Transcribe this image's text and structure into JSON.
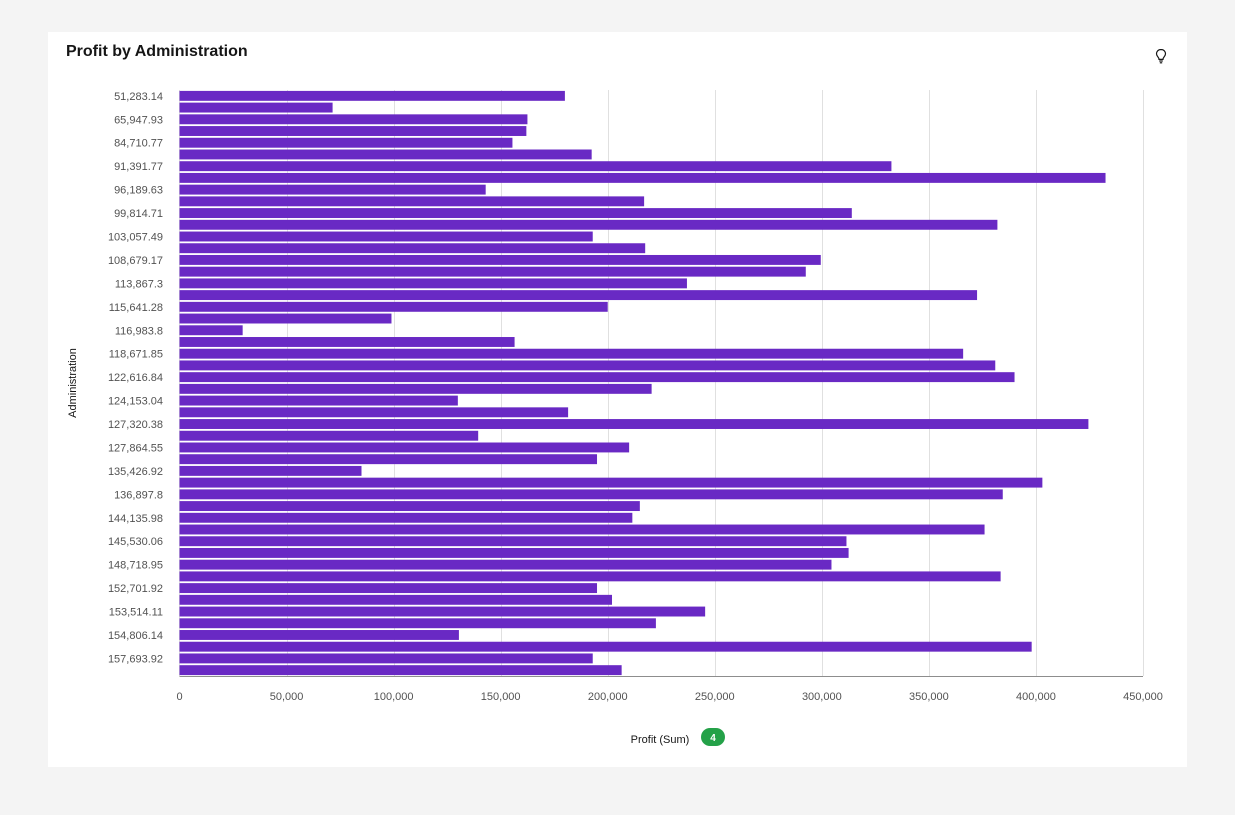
{
  "title": "Profit by Administration",
  "icons": {
    "insight": "lightbulb-icon"
  },
  "colors": {
    "bar": "#6929c4",
    "grid": "#e0e0e0",
    "axis": "#8d8d8d",
    "badge": "#24a148"
  },
  "badge": {
    "count": "4"
  },
  "chart_data": {
    "type": "bar",
    "orientation": "horizontal",
    "title": "Profit by Administration",
    "xlabel": "Profit (Sum)",
    "ylabel": "Administration",
    "xlim": [
      0,
      450000
    ],
    "xticks": [
      "0",
      "50,000",
      "100,000",
      "150,000",
      "200,000",
      "250,000",
      "300,000",
      "350,000",
      "400,000",
      "450,000"
    ],
    "tick_values": [
      0,
      50000,
      100000,
      150000,
      200000,
      250000,
      300000,
      350000,
      400000,
      450000
    ],
    "category_labels": [
      "51,283.14",
      "65,947.93",
      "84,710.77",
      "91,391.77",
      "96,189.63",
      "99,814.71",
      "103,057.49",
      "108,679.17",
      "113,867.3",
      "115,641.28",
      "116,983.8",
      "118,671.85",
      "122,616.84",
      "124,153.04",
      "127,320.38",
      "127,864.55",
      "135,426.92",
      "136,897.8",
      "144,135.98",
      "145,530.06",
      "148,718.95",
      "152,701.92",
      "153,514.11",
      "154,806.14",
      "157,693.92"
    ],
    "label_every": 2,
    "grid": true,
    "values": [
      180000,
      71500,
      162500,
      162000,
      155500,
      192500,
      332500,
      432500,
      143000,
      217000,
      314000,
      382000,
      193000,
      217500,
      299500,
      292500,
      237000,
      372500,
      200000,
      99000,
      29500,
      156500,
      366000,
      381000,
      390000,
      220500,
      130000,
      181500,
      424500,
      139500,
      210000,
      195000,
      85000,
      403000,
      384500,
      215000,
      211500,
      376000,
      311500,
      312500,
      304500,
      383500,
      195000,
      202000,
      245500,
      222500,
      130500,
      398000,
      193000,
      206500
    ]
  }
}
